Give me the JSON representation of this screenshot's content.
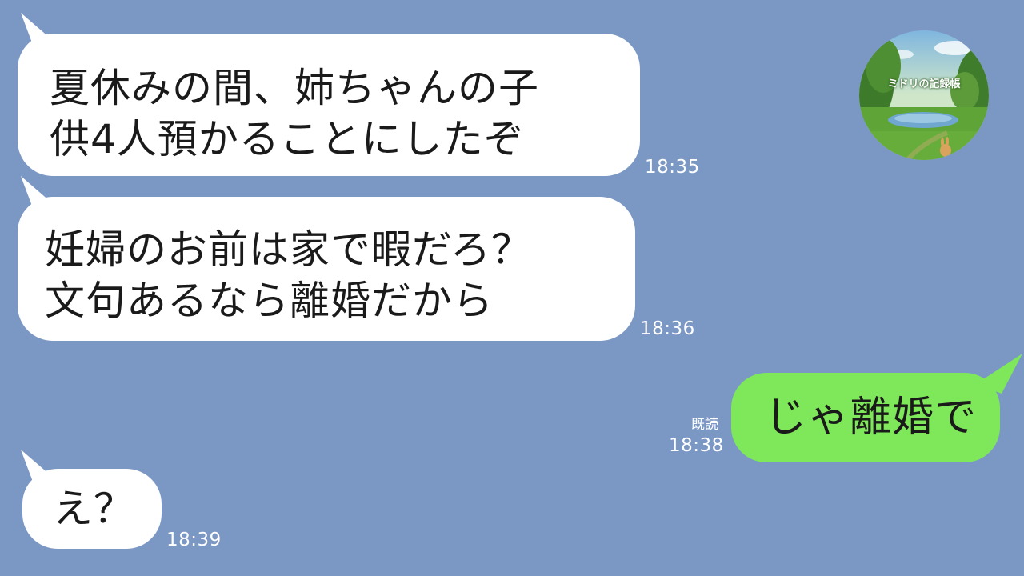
{
  "conversation": {
    "messages": [
      {
        "direction": "received",
        "text": "夏休みの間、姉ちゃんの子\n供4人預かることにしたぞ",
        "time": "18:35"
      },
      {
        "direction": "received",
        "text": "妊婦のお前は家で暇だろ？\n文句あるなら離婚だから",
        "time": "18:36"
      },
      {
        "direction": "sent",
        "text": "じゃ離婚で",
        "read_status": "既読",
        "time": "18:38"
      },
      {
        "direction": "received",
        "text": "え？",
        "time": "18:39"
      }
    ]
  },
  "avatar": {
    "label": "ミドリの記録帳",
    "icon": "landscape-avatar-icon"
  },
  "colors": {
    "background": "#7b98c5",
    "received_bubble": "#ffffff",
    "sent_bubble": "#7ee85a",
    "timestamp": "#ffffff"
  }
}
